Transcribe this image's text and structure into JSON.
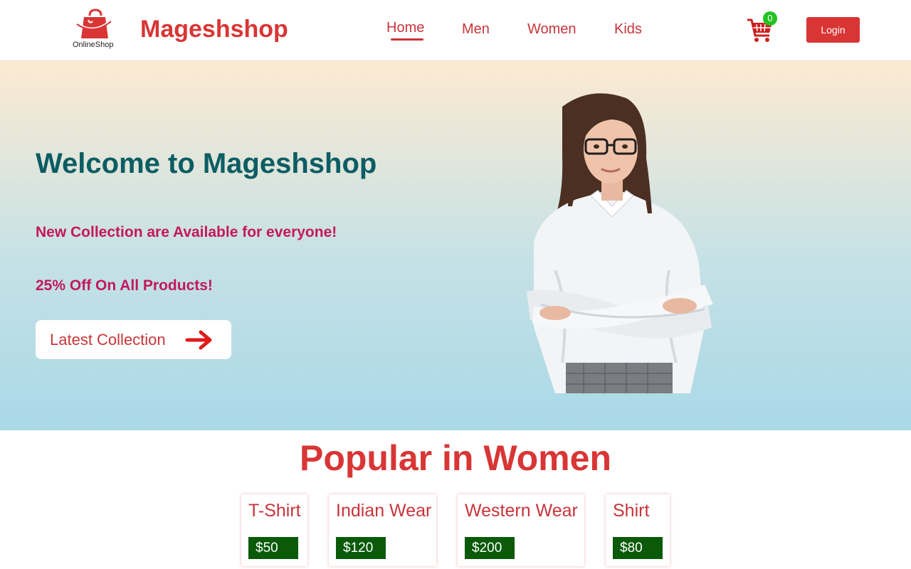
{
  "header": {
    "logo_text": "OnlineShop",
    "brand": "Mageshshop",
    "nav": [
      {
        "label": "Home",
        "active": true
      },
      {
        "label": "Men",
        "active": false
      },
      {
        "label": "Women",
        "active": false
      },
      {
        "label": "Kids",
        "active": false
      }
    ],
    "cart_icon": "shopping-cart-icon",
    "cart_count": "0",
    "login_label": "Login"
  },
  "hero": {
    "title": "Welcome to Mageshshop",
    "subtitle1": "New Collection are Available for everyone!",
    "subtitle2": "25% Off On All Products!",
    "cta_label": "Latest Collection",
    "cta_icon": "arrow-right-icon"
  },
  "popular": {
    "title": "Popular in Women",
    "products": [
      {
        "name": "T-Shirt",
        "price": "$50"
      },
      {
        "name": "Indian Wear",
        "price": "$120"
      },
      {
        "name": "Western Wear",
        "price": "$200"
      },
      {
        "name": "Shirt",
        "price": "$80"
      }
    ]
  },
  "colors": {
    "brand_red": "#d93535",
    "title_teal": "#0c5d63",
    "subtitle_pink": "#c4185a",
    "price_green": "#0a5a0a",
    "badge_green": "#22c322"
  }
}
